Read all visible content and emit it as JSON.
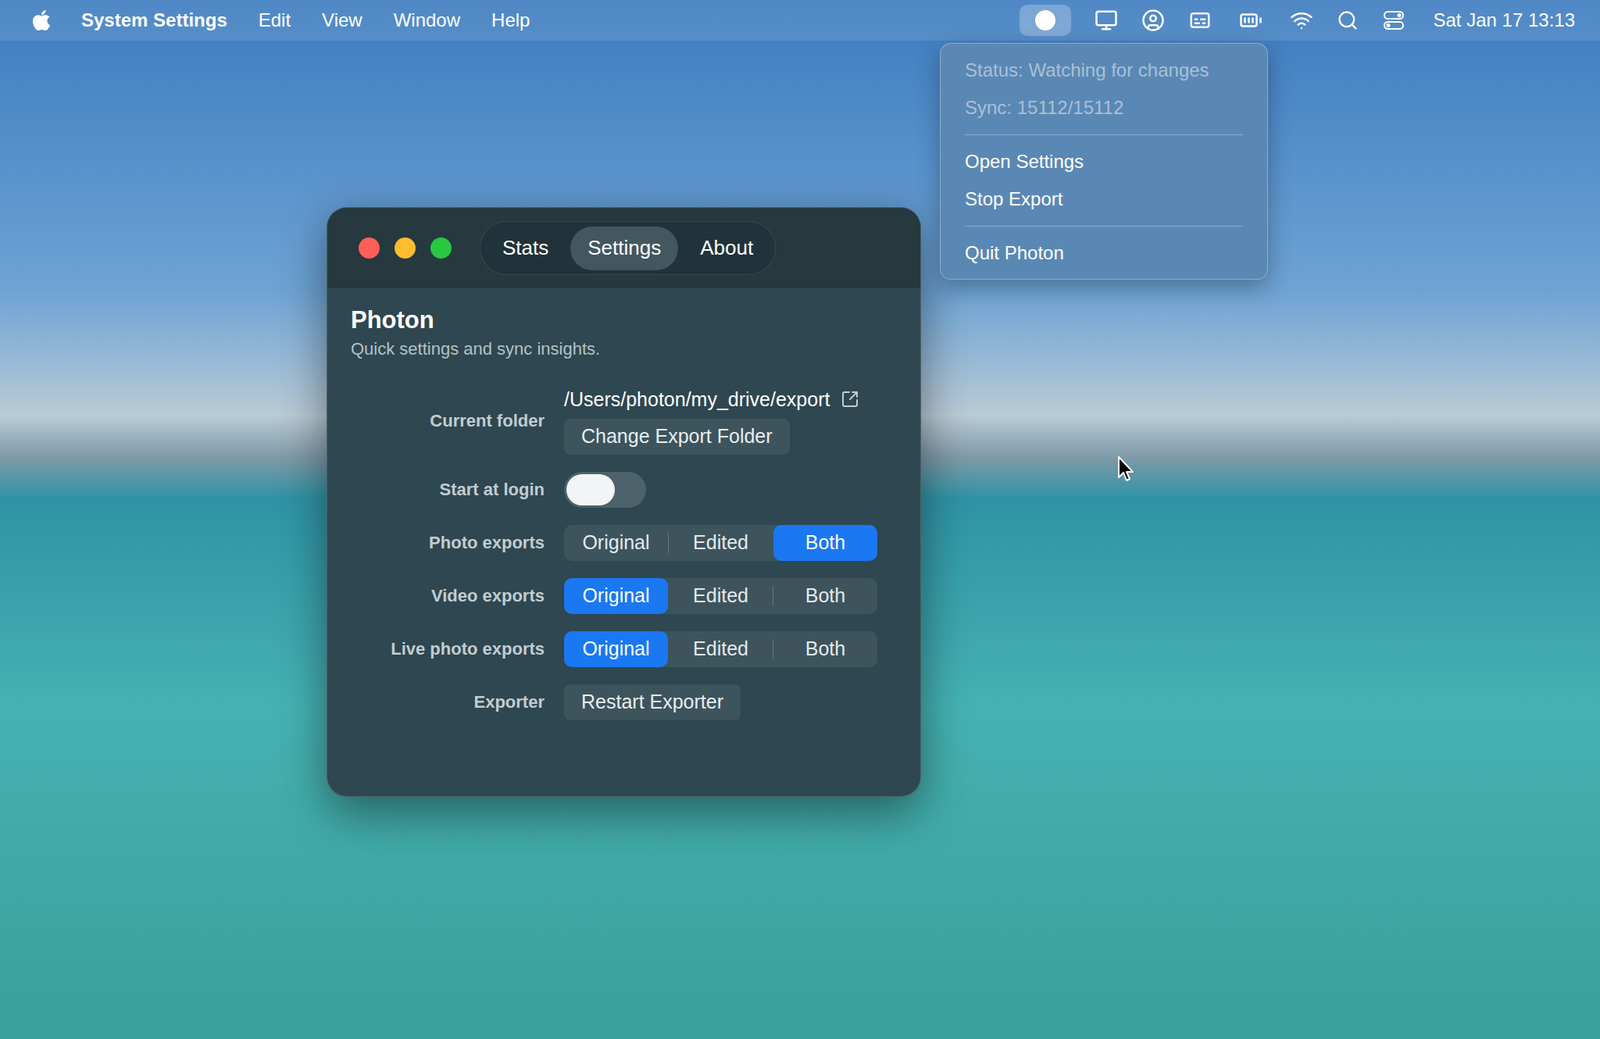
{
  "menu_bar": {
    "app_name": "System Settings",
    "menus": [
      "Edit",
      "View",
      "Window",
      "Help"
    ],
    "clock": "Sat Jan 17 13:13",
    "status_item_highlighted": true
  },
  "status_menu": {
    "groups": [
      [
        {
          "label": "Status: Watching for changes",
          "disabled": true
        },
        {
          "label": "Sync: 15112/15112",
          "disabled": true
        }
      ],
      [
        {
          "label": "Open Settings",
          "disabled": false
        },
        {
          "label": "Stop Export",
          "disabled": false
        }
      ],
      [
        {
          "label": "Quit Photon",
          "disabled": false
        }
      ]
    ]
  },
  "window": {
    "tabs": [
      {
        "label": "Stats",
        "selected": false
      },
      {
        "label": "Settings",
        "selected": true
      },
      {
        "label": "About",
        "selected": false
      }
    ],
    "title": "Photon",
    "subtitle": "Quick settings and sync insights.",
    "current_folder": {
      "label": "Current folder",
      "path": "/Users/photon/my_drive/export",
      "button": "Change Export Folder"
    },
    "start_at_login": {
      "label": "Start at login",
      "on": false
    },
    "export_options": [
      {
        "label": "Photo exports",
        "options": [
          {
            "label": "Original",
            "selected": false
          },
          {
            "label": "Edited",
            "selected": false
          },
          {
            "label": "Both",
            "selected": true
          }
        ]
      },
      {
        "label": "Video exports",
        "options": [
          {
            "label": "Original",
            "selected": true
          },
          {
            "label": "Edited",
            "selected": false
          },
          {
            "label": "Both",
            "selected": false
          }
        ]
      },
      {
        "label": "Live photo exports",
        "options": [
          {
            "label": "Original",
            "selected": true
          },
          {
            "label": "Edited",
            "selected": false
          },
          {
            "label": "Both",
            "selected": false
          }
        ]
      }
    ],
    "exporter": {
      "label": "Exporter",
      "button": "Restart Exporter"
    }
  }
}
